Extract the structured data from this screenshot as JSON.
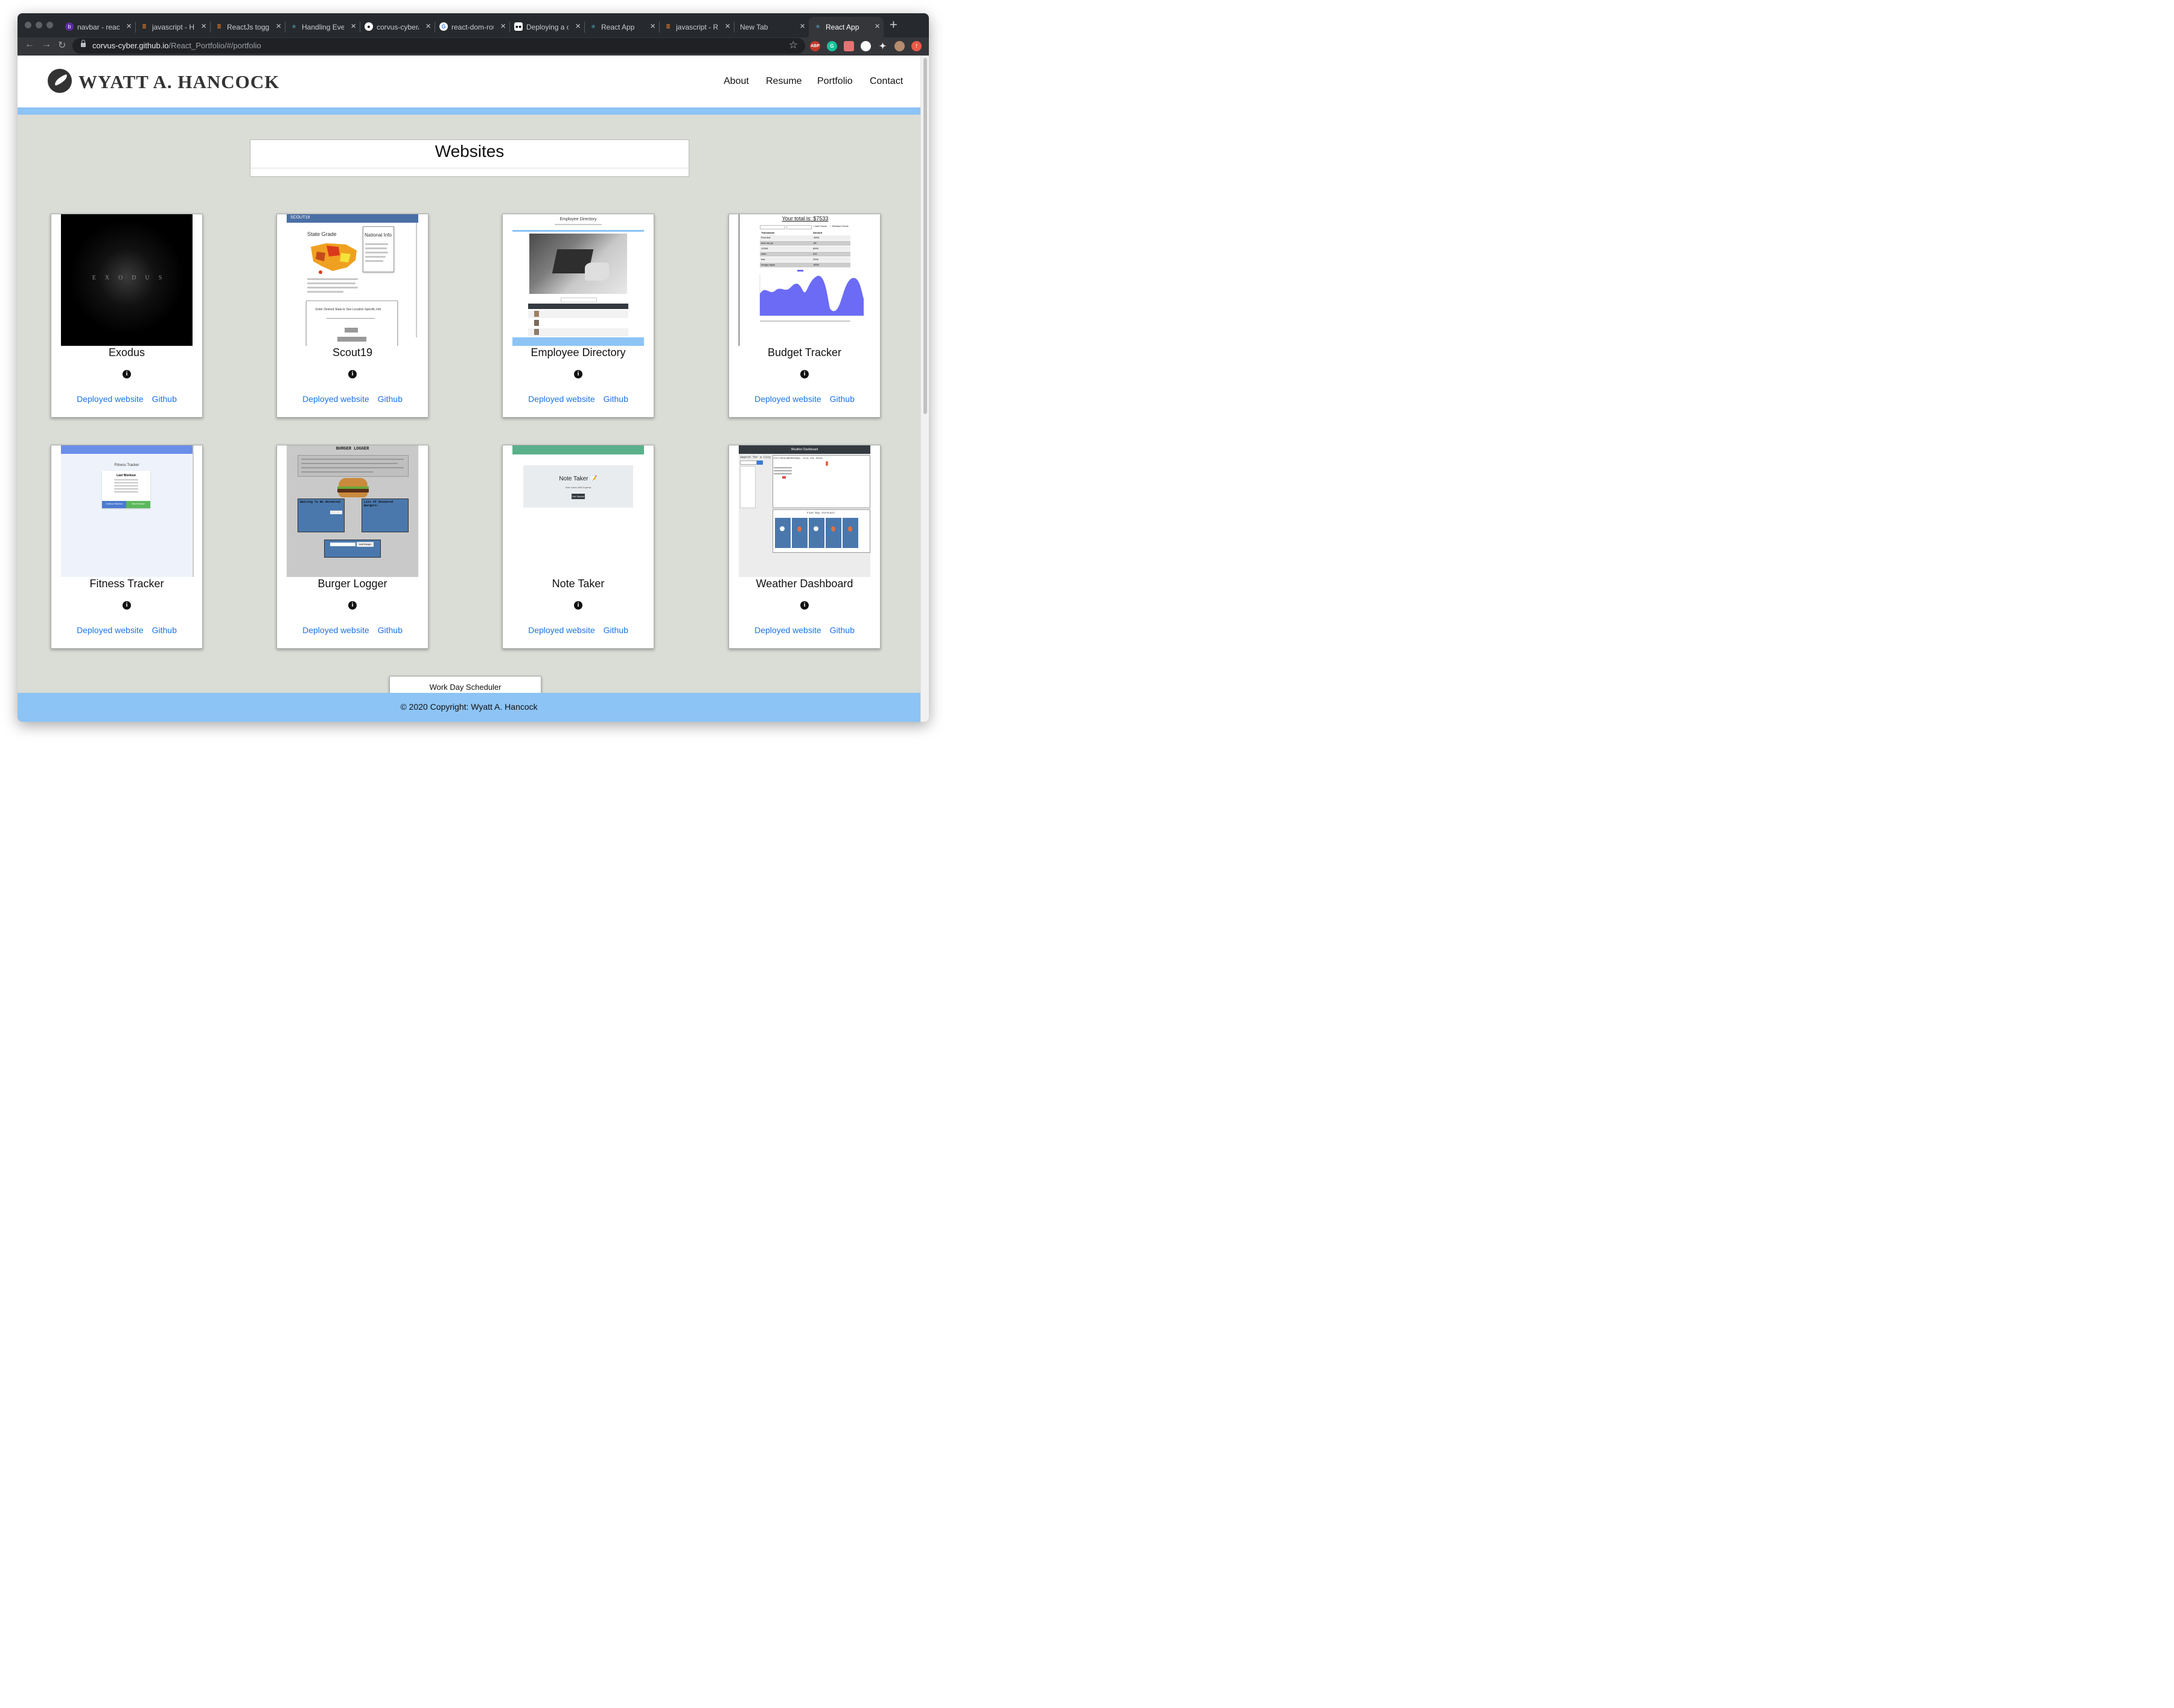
{
  "browser": {
    "tabs": [
      {
        "label": "navbar - react",
        "icon": "bit-icon"
      },
      {
        "label": "javascript - How",
        "icon": "stackoverflow-icon"
      },
      {
        "label": "ReactJs toggle",
        "icon": "stackoverflow-icon"
      },
      {
        "label": "Handling Events",
        "icon": "react-icon"
      },
      {
        "label": "corvus-cyber/",
        "icon": "github-icon"
      },
      {
        "label": "react-dom-router",
        "icon": "google-icon"
      },
      {
        "label": "Deploying a create",
        "icon": "medium-icon"
      },
      {
        "label": "React App",
        "icon": "react-icon"
      },
      {
        "label": "javascript - React",
        "icon": "stackoverflow-icon"
      },
      {
        "label": "New Tab",
        "icon": ""
      },
      {
        "label": "React App",
        "icon": "react-icon"
      }
    ],
    "url_host": "corvus-cyber.github.io",
    "url_path": "/React_Portfolio/#/portfolio",
    "extensions": [
      "ABP",
      "G",
      "",
      "",
      "",
      ""
    ]
  },
  "site": {
    "brand": "WYATT A. HANCOCK",
    "nav": [
      "About",
      "Resume",
      "Portfolio",
      "Contact"
    ],
    "section_title": "Websites",
    "deployed_label": "Deployed website",
    "github_label": "Github",
    "info_glyph": "i",
    "projects": [
      {
        "title": "Exodus"
      },
      {
        "title": "Scout19"
      },
      {
        "title": "Employee Directory"
      },
      {
        "title": "Budget Tracker"
      },
      {
        "title": "Fitness Tracker"
      },
      {
        "title": "Burger Logger"
      },
      {
        "title": "Note Taker"
      },
      {
        "title": "Weather Dashboard"
      }
    ],
    "partial_project": "Work Day Scheduler",
    "footer": "© 2020 Copyright: Wyatt A. Hancock"
  },
  "thumbnails": {
    "exodus_text": "EXODUS",
    "scout_brand": "SCOUT19",
    "scout_state_grade": "State Grade",
    "scout_national_info": "National Info",
    "scout_location_prompt": "Enter Desired State to See Location Specific Info",
    "emp_title": "Employee Directory",
    "budget_total": "Your total is: $7533",
    "budget_headers": [
      "Transaction",
      "Amount"
    ],
    "budget_rows": [
      [
        "First test",
        "-3000"
      ],
      [
        "here we go",
        "-80"
      ],
      [
        "12345",
        "6000"
      ],
      [
        "hello",
        "420"
      ],
      [
        "test",
        "3334"
      ],
      [
        "hungry hippo",
        "-8000"
      ]
    ],
    "budget_buttons": [
      "+ Add Funds",
      "− Subtract Funds"
    ],
    "fitness_title": "Fitness Tracker",
    "fitness_last": "Last Workout",
    "fitness_buttons": [
      "Continue Workout",
      "New Workout"
    ],
    "burger_title": "BURGER LOGGER",
    "burger_waiting": "Waiting To Be Devoured:",
    "burger_list": "List Of Devoured Burgers:",
    "burger_add": "Add Burger",
    "note_title": "Note Taker 📝",
    "note_sub": "Take notes with Express",
    "note_button": "Get Started",
    "weather_title": "Weather Dashboard",
    "weather_search": "Search for a City",
    "weather_city": "Portland(Wednesday, July 1st 2020)",
    "weather_forecast": "Five Day Forecast"
  },
  "colors": {
    "accent_blue": "#8cc4f5",
    "link_blue": "#1a73e8",
    "page_bg": "#dadcd6",
    "budget_chart": "#6b6bf5"
  }
}
